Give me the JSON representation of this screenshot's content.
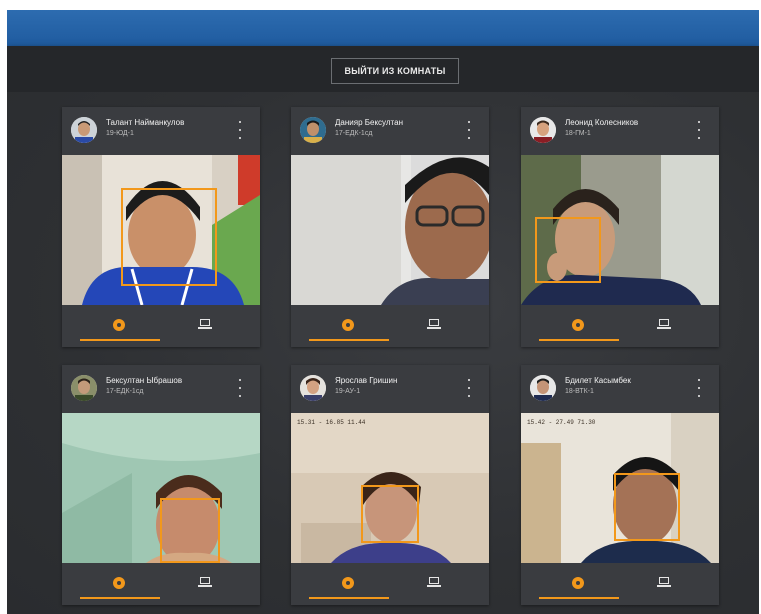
{
  "toolbar": {
    "leave_label": "ВЫЙТИ ИЗ КОМНАТЫ"
  },
  "colors": {
    "topbar": "#1f5b9f",
    "accent": "#f2981b",
    "card": "#3a3c40",
    "background": "#2c2e31"
  },
  "icons": {
    "menu": "kebab-menu-icon",
    "camera": "camera-icon",
    "screen": "laptop-icon"
  },
  "participants": [
    {
      "name": "Талант Найманкулов",
      "group": "19-ЮД-1"
    },
    {
      "name": "Данияр Бексултан",
      "group": "17-ЕДК-1сд"
    },
    {
      "name": "Леонид Колесников",
      "group": "18-ГМ-1"
    },
    {
      "name": "Бексултан Ыбрашов",
      "group": "17-ЕДК-1сд"
    },
    {
      "name": "Ярослав Гришин",
      "group": "19-АУ-1"
    },
    {
      "name": "Бдилет Касымбек",
      "group": "18-ВТК-1",
      "overlay": "15.42 - 27.49 71.30"
    }
  ],
  "participant_4_overlay": "15.31 - 16.85 11.44"
}
